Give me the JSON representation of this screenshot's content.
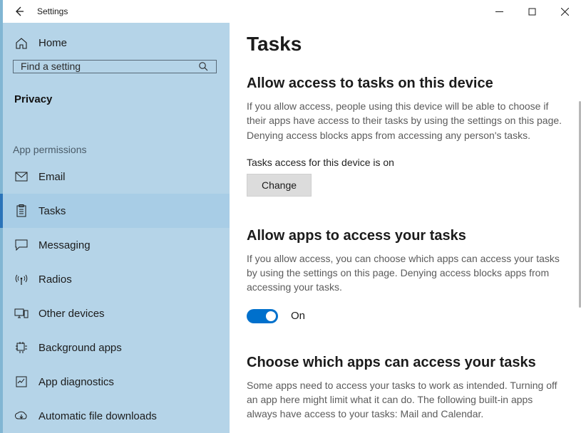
{
  "window": {
    "title": "Settings"
  },
  "sidebar": {
    "home_label": "Home",
    "search_placeholder": "Find a setting",
    "category": "Privacy",
    "subgroup": "App permissions",
    "items": [
      {
        "id": "email",
        "label": "Email"
      },
      {
        "id": "tasks",
        "label": "Tasks"
      },
      {
        "id": "messaging",
        "label": "Messaging"
      },
      {
        "id": "radios",
        "label": "Radios"
      },
      {
        "id": "other-devices",
        "label": "Other devices"
      },
      {
        "id": "background-apps",
        "label": "Background apps"
      },
      {
        "id": "app-diagnostics",
        "label": "App diagnostics"
      },
      {
        "id": "auto-file-downloads",
        "label": "Automatic file downloads"
      }
    ],
    "active_id": "tasks"
  },
  "page": {
    "heading": "Tasks",
    "section1": {
      "title": "Allow access to tasks on this device",
      "desc": "If you allow access, people using this device will be able to choose if their apps have access to their tasks by using the settings on this page. Denying access blocks apps from accessing any person's tasks.",
      "status": "Tasks access for this device is on",
      "change_label": "Change"
    },
    "section2": {
      "title": "Allow apps to access your tasks",
      "desc": "If you allow access, you can choose which apps can access your tasks by using the settings on this page. Denying access blocks apps from accessing your tasks.",
      "toggle_label": "On",
      "toggle_state": true
    },
    "section3": {
      "title": "Choose which apps can access your tasks",
      "desc": "Some apps need to access your tasks to work as intended. Turning off an app here might limit what it can do. The following built-in apps always have access to your tasks: Mail and Calendar."
    }
  }
}
